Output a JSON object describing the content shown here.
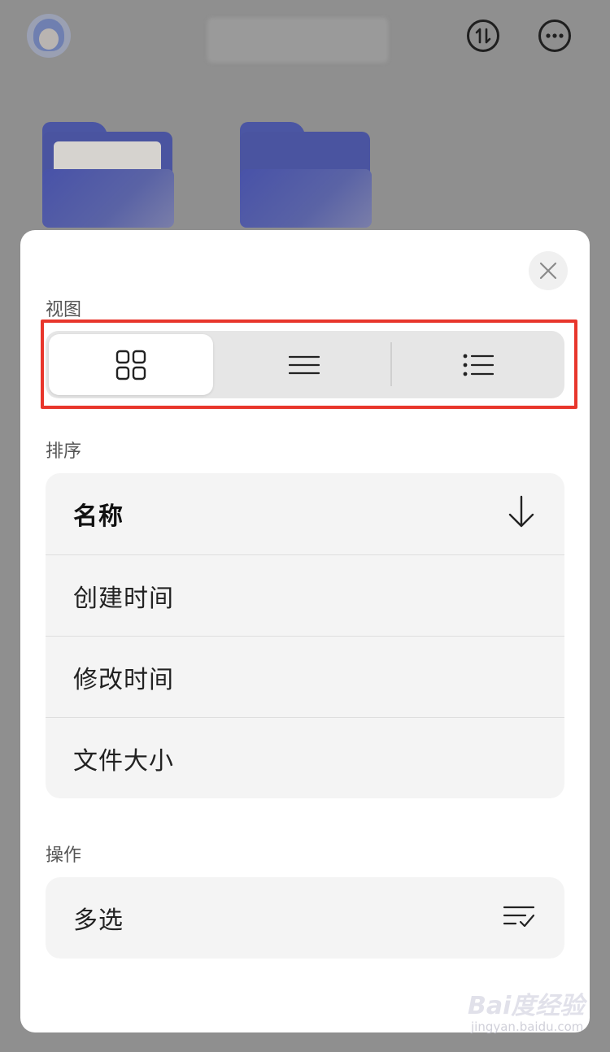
{
  "header": {
    "avatar_icon": "girl-avatar-icon",
    "sort_button_icon": "sort-arrows-icon",
    "more_button_icon": "more-dots-icon"
  },
  "sheet": {
    "close_icon": "close-icon",
    "view_section": {
      "label": "视图",
      "highlight_color": "#e8362c",
      "options": [
        {
          "icon": "grid-view-icon",
          "selected": true
        },
        {
          "icon": "list-view-icon",
          "selected": false
        },
        {
          "icon": "detail-list-view-icon",
          "selected": false
        }
      ]
    },
    "sort_section": {
      "label": "排序",
      "items": [
        {
          "label": "名称",
          "selected": true,
          "icon": "arrow-down-icon"
        },
        {
          "label": "创建时间"
        },
        {
          "label": "修改时间"
        },
        {
          "label": "文件大小"
        }
      ]
    },
    "action_section": {
      "label": "操作",
      "items": [
        {
          "label": "多选",
          "icon": "multi-select-icon"
        }
      ]
    }
  },
  "watermark": {
    "brand": "Bai度经验",
    "url": "jingyan.baidu.com"
  }
}
